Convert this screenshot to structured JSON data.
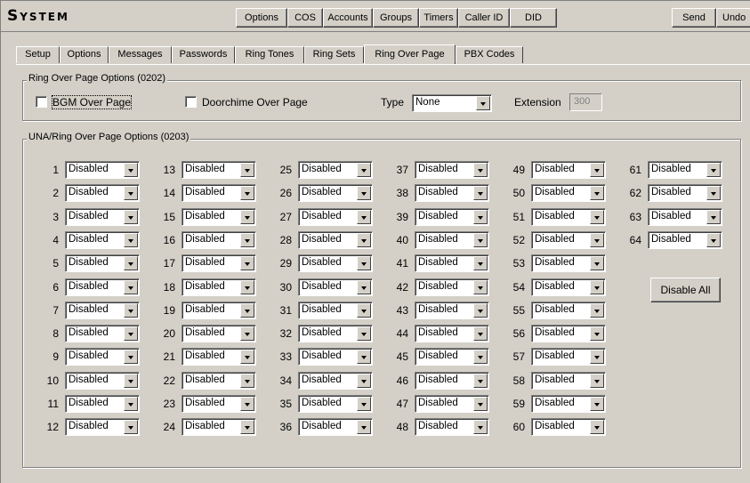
{
  "app_title": "System",
  "toolbar": [
    "Options",
    "COS",
    "Accounts",
    "Groups",
    "Timers",
    "Caller ID",
    "DID",
    "Send",
    "Undo"
  ],
  "tabs": [
    "Setup",
    "Options",
    "Messages",
    "Passwords",
    "Ring Tones",
    "Ring Sets",
    "Ring Over Page",
    "PBX Codes"
  ],
  "active_tab": "Ring Over Page",
  "ring_over_page": {
    "legend": "Ring Over Page Options (0202)",
    "bgm_label": "BGM Over Page",
    "bgm_checked": false,
    "doorchime_label": "Doorchime Over Page",
    "doorchime_checked": false,
    "type_label": "Type",
    "type_value": "None",
    "extension_label": "Extension",
    "extension_value": "300"
  },
  "una": {
    "legend": "UNA/Ring Over Page Options (0203)",
    "default_value": "Disabled",
    "count": 64,
    "disable_all_label": "Disable All"
  }
}
